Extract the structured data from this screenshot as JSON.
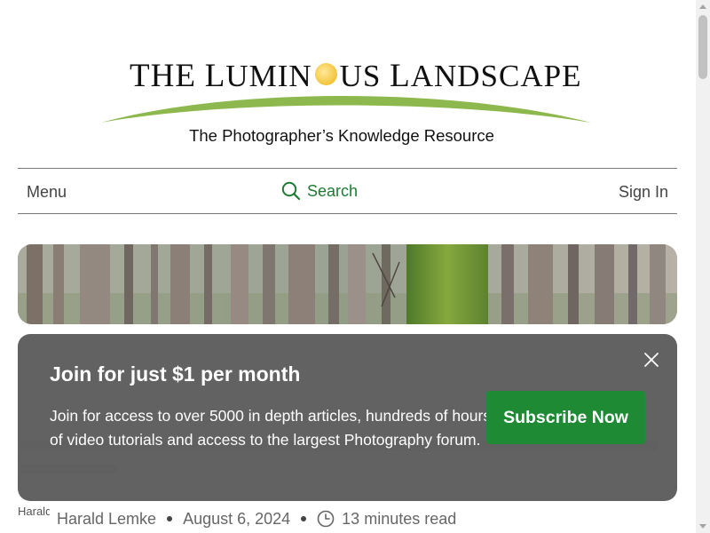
{
  "logo": {
    "title_the": "THE",
    "title_lumin_initial": "L",
    "title_lumin_rest": "UMIN",
    "title_us": "US",
    "title_landscape_initial": "L",
    "title_landscape_rest": "ANDSCAPE",
    "tagline": "The Photographer’s Knowledge Resource",
    "sun_icon": "sun-icon",
    "swoosh_color": "#8db84d"
  },
  "nav": {
    "menu_label": "Menu",
    "search_label": "Search",
    "signin_label": "Sign In",
    "search_icon": "search-icon",
    "accent_color": "#1e7a33"
  },
  "popup": {
    "title": "Join for just $1 per month",
    "body": "Join for access to over 5000 in depth articles, hundreds of hours of video tutorials and access to the largest Photography forum.",
    "cta_label": "Subscribe Now",
    "close_icon": "close-icon",
    "cta_color": "#1e8a34"
  },
  "article": {
    "author_avatar_alt": "Harald",
    "author": "Harald Lemke",
    "date": "August 6, 2024",
    "read_time": "13 minutes read",
    "clock_icon": "clock-icon"
  }
}
